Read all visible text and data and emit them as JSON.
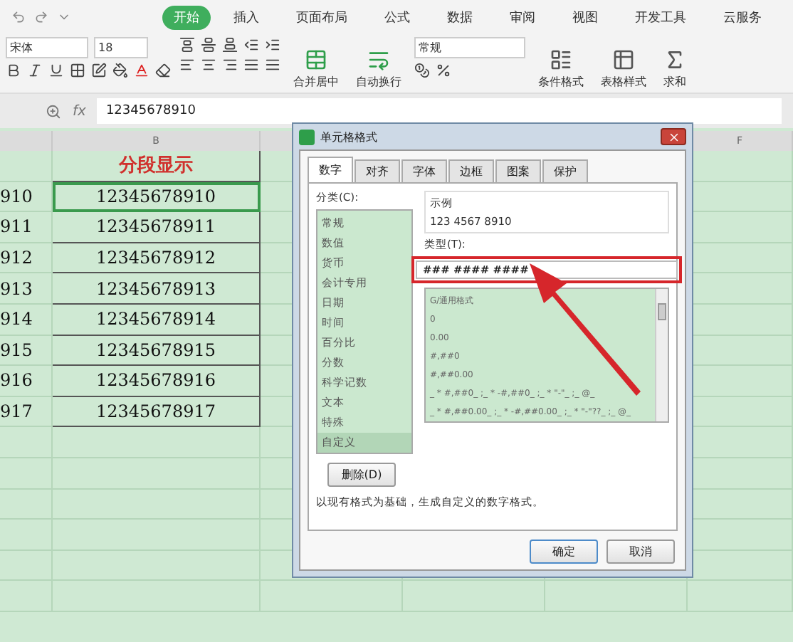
{
  "ribbon_tabs": [
    {
      "label": "开始",
      "selected": true
    },
    {
      "label": "插入",
      "selected": false
    },
    {
      "label": "页面布局",
      "selected": false
    },
    {
      "label": "公式",
      "selected": false
    },
    {
      "label": "数据",
      "selected": false
    },
    {
      "label": "审阅",
      "selected": false
    },
    {
      "label": "视图",
      "selected": false
    },
    {
      "label": "开发工具",
      "selected": false
    },
    {
      "label": "云服务",
      "selected": false
    }
  ],
  "font": {
    "name": "宋体",
    "size": "18"
  },
  "number_format": "常规",
  "ribbon_buttons": [
    "合并居中",
    "自动换行",
    "条件格式",
    "表格样式",
    "求和"
  ],
  "formula_bar": {
    "fx": "fx",
    "value": "12345678910"
  },
  "sheet": {
    "columns": [
      {
        "label": "B"
      },
      {
        "label": "F"
      }
    ],
    "rows": [
      {
        "a": "",
        "b": "分段显示",
        "kind": "header",
        "selected": false
      },
      {
        "a": "910",
        "b": "12345678910",
        "kind": "data",
        "selected": true
      },
      {
        "a": "911",
        "b": "12345678911",
        "kind": "data",
        "selected": false
      },
      {
        "a": "912",
        "b": "12345678912",
        "kind": "data",
        "selected": false
      },
      {
        "a": "913",
        "b": "12345678913",
        "kind": "data",
        "selected": false
      },
      {
        "a": "914",
        "b": "12345678914",
        "kind": "data",
        "selected": false
      },
      {
        "a": "915",
        "b": "12345678915",
        "kind": "data",
        "selected": false
      },
      {
        "a": "916",
        "b": "12345678916",
        "kind": "data",
        "selected": false
      },
      {
        "a": "917",
        "b": "12345678917",
        "kind": "data",
        "selected": false
      }
    ]
  },
  "dialog": {
    "title": "单元格格式",
    "tabs": [
      {
        "label": "数字",
        "selected": true
      },
      {
        "label": "对齐",
        "selected": false
      },
      {
        "label": "字体",
        "selected": false
      },
      {
        "label": "边框",
        "selected": false
      },
      {
        "label": "图案",
        "selected": false
      },
      {
        "label": "保护",
        "selected": false
      }
    ],
    "category_label": "分类(C):",
    "categories": [
      {
        "label": "常规",
        "selected": false
      },
      {
        "label": "数值",
        "selected": false
      },
      {
        "label": "货币",
        "selected": false
      },
      {
        "label": "会计专用",
        "selected": false
      },
      {
        "label": "日期",
        "selected": false
      },
      {
        "label": "时间",
        "selected": false
      },
      {
        "label": "百分比",
        "selected": false
      },
      {
        "label": "分数",
        "selected": false
      },
      {
        "label": "科学记数",
        "selected": false
      },
      {
        "label": "文本",
        "selected": false
      },
      {
        "label": "特殊",
        "selected": false
      },
      {
        "label": "自定义",
        "selected": true
      }
    ],
    "sample_label": "示例",
    "sample": "123 4567 8910",
    "type_label": "类型(T):",
    "type_value": "### #### ####",
    "formats": [
      "G/通用格式",
      "0",
      "0.00",
      "#,##0",
      "#,##0.00",
      "_ * #,##0_ ;_ * -#,##0_ ;_ * \"-\"_ ;_ @_",
      "_ * #,##0.00_ ;_ * -#,##0.00_ ;_ * \"-\"??_ ;_ @_"
    ],
    "delete_button": "删除(D)",
    "description": "以现有格式为基础，生成自定义的数字格式。",
    "buttons": [
      "确定",
      "取消"
    ]
  }
}
